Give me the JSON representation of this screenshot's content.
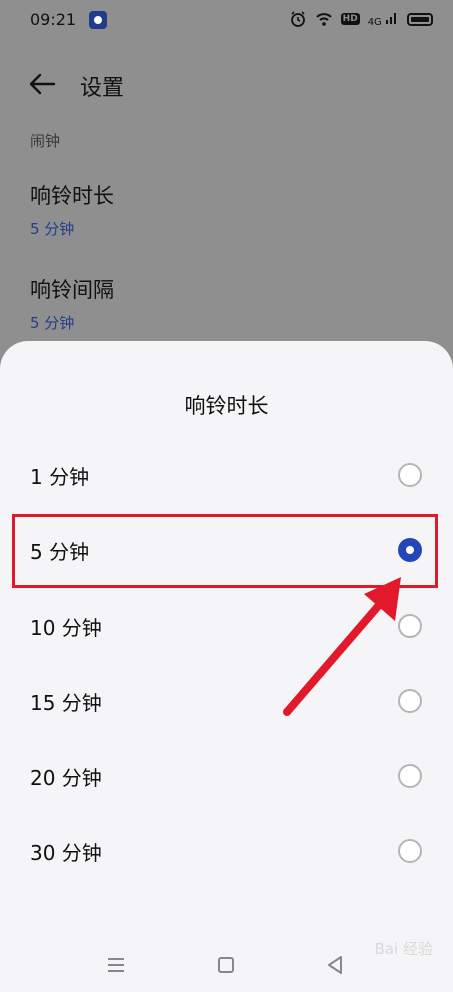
{
  "status_bar": {
    "time": "09:21",
    "hd_label": "HD",
    "signal_label": "4G"
  },
  "header": {
    "title": "设置"
  },
  "settings": {
    "section_label": "闹钟",
    "items": [
      {
        "title": "响铃时长",
        "value": "5 分钟"
      },
      {
        "title": "响铃间隔",
        "value": "5 分钟"
      }
    ]
  },
  "sheet": {
    "title": "响铃时长",
    "options": [
      {
        "label": "1 分钟",
        "selected": false
      },
      {
        "label": "5 分钟",
        "selected": true
      },
      {
        "label": "10 分钟",
        "selected": false
      },
      {
        "label": "15 分钟",
        "selected": false
      },
      {
        "label": "20 分钟",
        "selected": false
      },
      {
        "label": "30 分钟",
        "selected": false
      }
    ]
  },
  "colors": {
    "accent": "#2346b8",
    "highlight": "#e11a2b",
    "value_text": "#243f8c"
  },
  "watermark": "Bai 经验"
}
